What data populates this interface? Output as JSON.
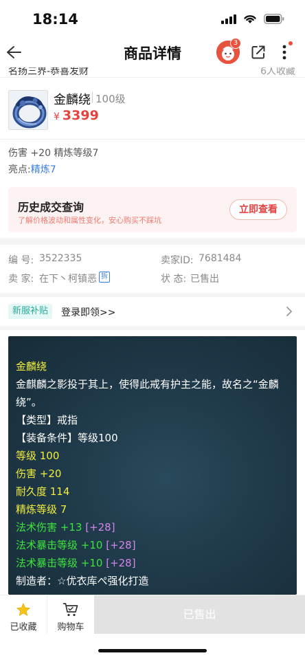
{
  "status_bar": {
    "time": "18:14"
  },
  "nav": {
    "title": "商品详情",
    "cart_badge": "3"
  },
  "cut_row": {
    "left": "名扬三界-恭喜发财",
    "right": "6人收藏"
  },
  "item": {
    "name": "金麟绕",
    "level": "100级",
    "currency": "¥",
    "price": "3399",
    "attributes": "伤害 +20 精炼等级7",
    "highlight_label": "亮点:",
    "highlight_value": "精炼7"
  },
  "history": {
    "title": "历史成交查询",
    "subtitle": "了解价格波动和属性变化，安心购买不踩坑",
    "button": "立即查看"
  },
  "info": {
    "id_label": "编 号:",
    "id_value": "3522335",
    "seller_id_label": "卖家ID:",
    "seller_id_value": "7681484",
    "seller_label": "卖 家:",
    "seller_value": "在下丶柯镇恶",
    "split_tag": "拆",
    "status_label": "状 态:",
    "status_value": "已售出"
  },
  "subsidy": {
    "tag": "新服补贴",
    "text": "登录即领>>"
  },
  "description": {
    "name": "金麟绕",
    "lore_1": "金麒麟之影投于其上，使得此戒有护主之能，故名之“金麟",
    "lore_2": "绕”。",
    "type": "【类型】戒指",
    "requirement": "【装备条件】等级100",
    "level": "等级 100",
    "damage": "伤害 +20",
    "durability": "耐久度 114",
    "refine": "精炼等级 7",
    "magic_dmg": "法术伤害 +13",
    "magic_dmg_bonus": "[+28]",
    "magic_crit_1": "法术暴击等级 +10",
    "magic_crit_1_bonus": "[+28]",
    "magic_crit_2": "法术暴击等级 +10",
    "magic_crit_2_bonus": "[+28]",
    "maker": "制造者：☆优衣库ぺ强化打造"
  },
  "bottom_bar": {
    "favorite": "已收藏",
    "cart": "购物车",
    "sold": "已售出"
  },
  "colors": {
    "price_red": "#e2433f",
    "link_blue": "#3a7de0",
    "panel_bg": "#1f3a4a",
    "star_yellow": "#f5c518"
  }
}
